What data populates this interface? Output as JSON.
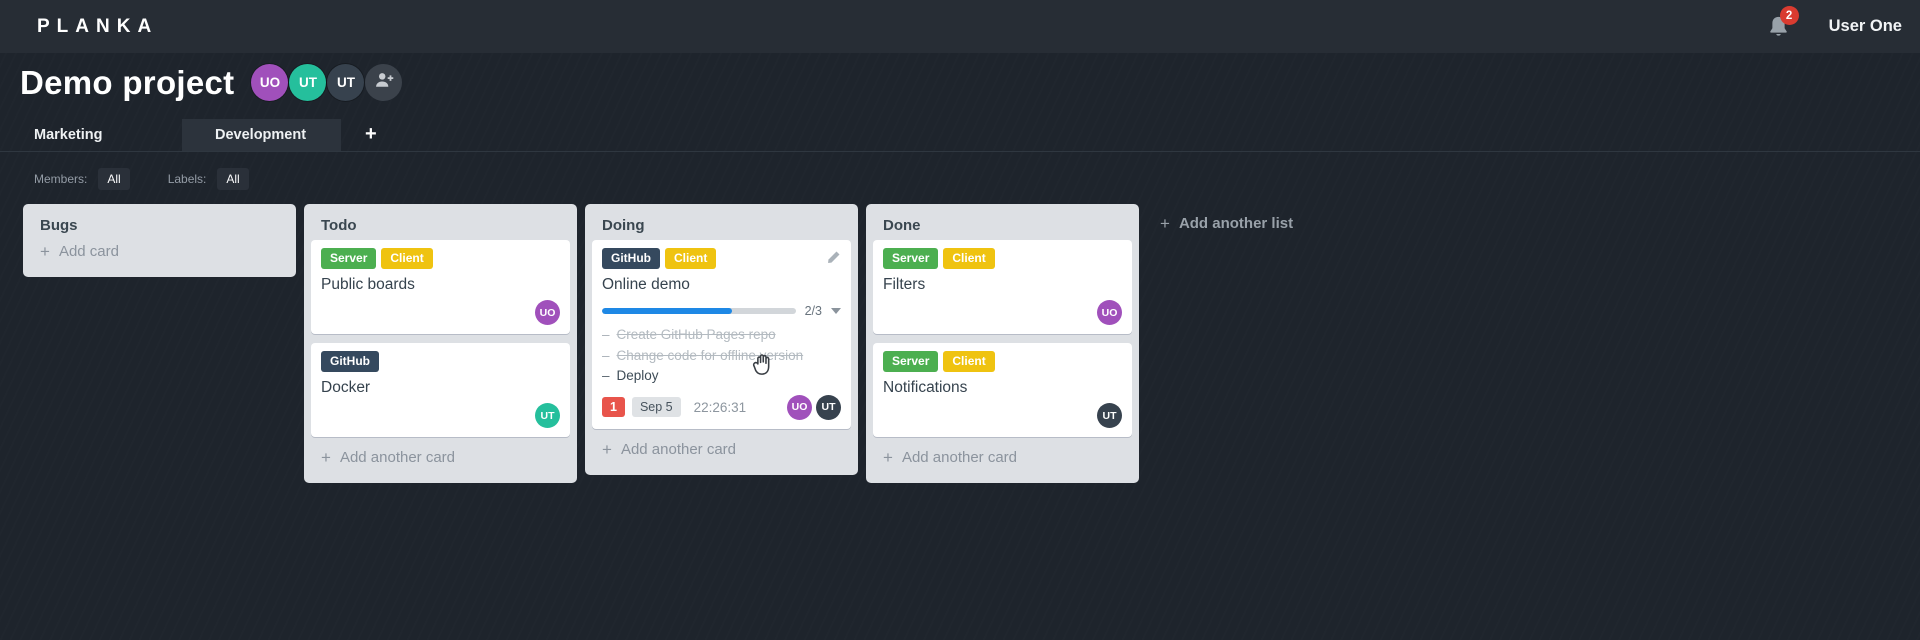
{
  "app": {
    "logo": "PLANKA",
    "notifications_count": "2",
    "user_name": "User One"
  },
  "icons": {
    "plus": "+"
  },
  "header": {
    "title": "Demo project",
    "members": [
      {
        "initials": "UO",
        "color": "#a050bb"
      },
      {
        "initials": "UT",
        "color": "#25bf9c"
      },
      {
        "initials": "UT",
        "color": "#37424e"
      }
    ]
  },
  "tabs": {
    "items": [
      {
        "label": "Marketing",
        "active": false
      },
      {
        "label": "Development",
        "active": true
      }
    ]
  },
  "filters": {
    "members_label": "Members:",
    "members_value": "All",
    "labels_label": "Labels:",
    "labels_value": "All"
  },
  "board": {
    "add_list_label": "Add another list",
    "lists": [
      {
        "title": "Bugs",
        "add_label": "Add card",
        "cards": []
      },
      {
        "title": "Todo",
        "add_label": "Add another card",
        "cards": [
          {
            "title": "Public boards",
            "labels": [
              {
                "text": "Server",
                "color": "#4caf50"
              },
              {
                "text": "Client",
                "color": "#efc310"
              }
            ],
            "members": [
              {
                "initials": "UO",
                "color": "#a050bb"
              }
            ]
          },
          {
            "title": "Docker",
            "labels": [
              {
                "text": "GitHub",
                "color": "#35495e"
              }
            ],
            "members": [
              {
                "initials": "UT",
                "color": "#25bf9c"
              }
            ]
          }
        ]
      },
      {
        "title": "Doing",
        "add_label": "Add another card",
        "cards": [
          {
            "title": "Online demo",
            "labels": [
              {
                "text": "GitHub",
                "color": "#35495e"
              },
              {
                "text": "Client",
                "color": "#efc310"
              }
            ],
            "progress": {
              "label": "2/3",
              "percent": "67%"
            },
            "tasks": [
              {
                "dash": "–",
                "text": "Create GitHub Pages repo",
                "completed": true
              },
              {
                "dash": "–",
                "text": "Change code for offline version",
                "completed": true
              },
              {
                "dash": "–",
                "text": "Deploy",
                "completed": false
              }
            ],
            "badges": {
              "notifications": "1",
              "due_date": "Sep 5",
              "timer": "22:26:31"
            },
            "members": [
              {
                "initials": "UO",
                "color": "#a050bb"
              },
              {
                "initials": "UT",
                "color": "#37424e"
              }
            ]
          }
        ]
      },
      {
        "title": "Done",
        "add_label": "Add another card",
        "cards": [
          {
            "title": "Filters",
            "labels": [
              {
                "text": "Server",
                "color": "#4caf50"
              },
              {
                "text": "Client",
                "color": "#efc310"
              }
            ],
            "members": [
              {
                "initials": "UO",
                "color": "#a050bb"
              }
            ]
          },
          {
            "title": "Notifications",
            "labels": [
              {
                "text": "Server",
                "color": "#4caf50"
              },
              {
                "text": "Client",
                "color": "#efc310"
              }
            ],
            "members": [
              {
                "initials": "UT",
                "color": "#37424e"
              }
            ]
          }
        ]
      }
    ]
  }
}
